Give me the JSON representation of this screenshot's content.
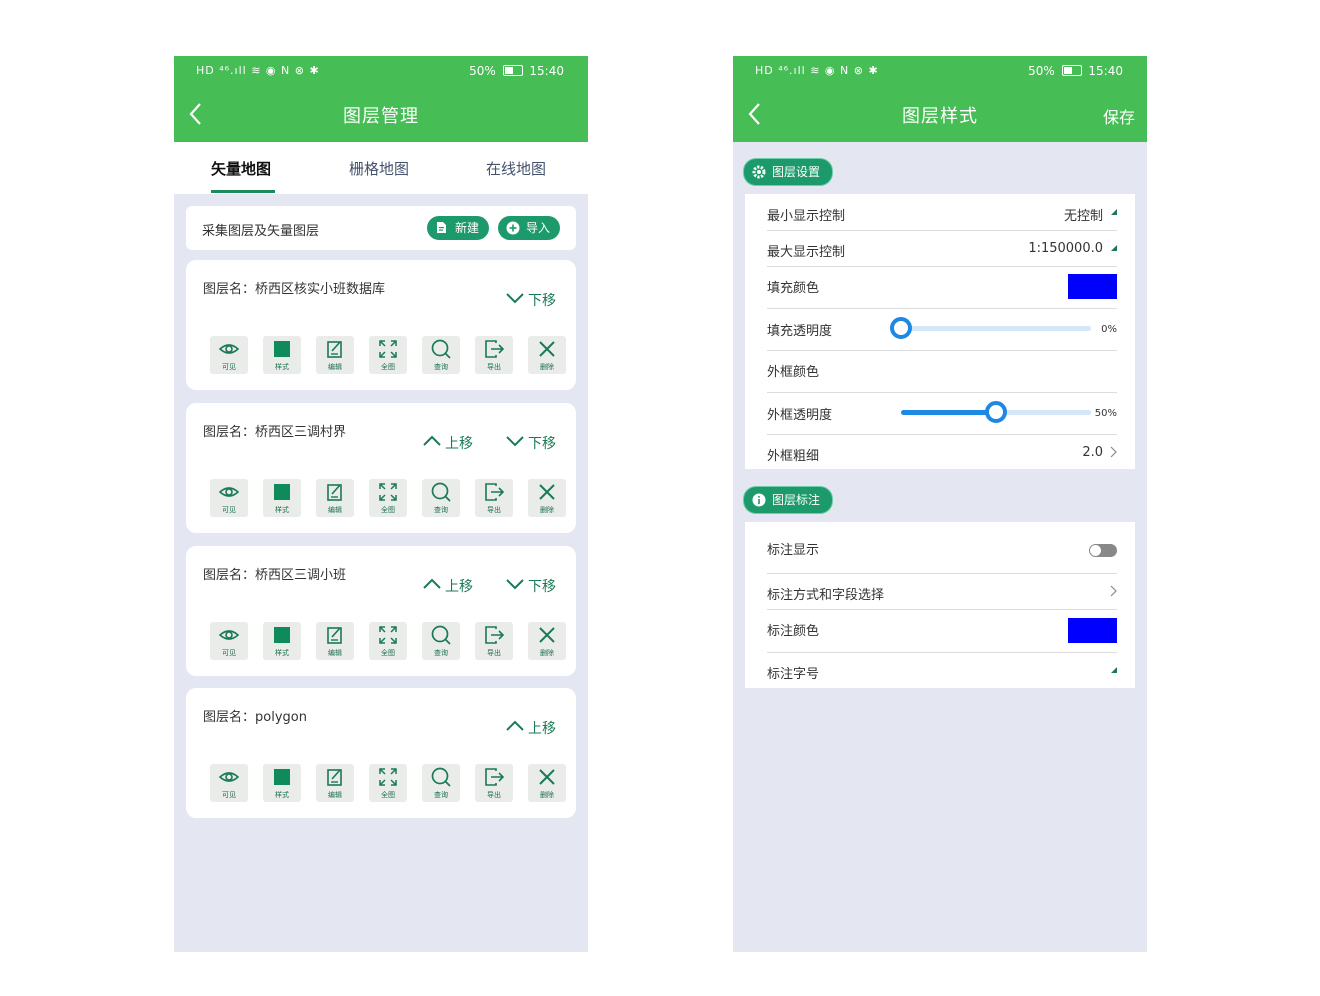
{
  "status_bar": {
    "icons_left": "HD ⁴⁶.ıll ≋ ◉ N ⊗ ✱",
    "battery_percent": "50%",
    "time": "15:40"
  },
  "left_screen": {
    "title": "图层管理",
    "tabs": [
      {
        "label": "矢量地图",
        "active": true
      },
      {
        "label": "栅格地图",
        "active": false
      },
      {
        "label": "在线地图",
        "active": false
      }
    ],
    "header": {
      "label": "采集图层及矢量图层",
      "new_button": "新建",
      "import_button": "导入"
    },
    "layers": [
      {
        "name": "图层名：桥西区核实小班数据库",
        "up": "",
        "down": "下移"
      },
      {
        "name": "图层名：桥西区三调村界",
        "up": "上移",
        "down": "下移"
      },
      {
        "name": "图层名：桥西区三调小班",
        "up": "上移",
        "down": "下移"
      },
      {
        "name": "图层名：polygon",
        "up": "上移",
        "down": ""
      }
    ],
    "tools": [
      {
        "icon": "eye-icon",
        "label": "可见"
      },
      {
        "icon": "square-icon",
        "label": "样式"
      },
      {
        "icon": "edit-icon",
        "label": "编辑"
      },
      {
        "icon": "expand-icon",
        "label": "全图"
      },
      {
        "icon": "search-icon",
        "label": "查询"
      },
      {
        "icon": "export-icon",
        "label": "导出"
      },
      {
        "icon": "close-icon",
        "label": "删除"
      }
    ]
  },
  "right_screen": {
    "title": "图层样式",
    "save_label": "保存",
    "settings_section": "图层设置",
    "settings": {
      "min_display_label": "最小显示控制",
      "min_display_value": "无控制",
      "max_display_label": "最大显示控制",
      "max_display_value": "1:150000.0",
      "fill_color_label": "填充颜色",
      "fill_color": "#0000ff",
      "fill_opacity_label": "填充透明度",
      "fill_opacity_text": "0%",
      "fill_opacity_value": 0,
      "border_color_label": "外框颜色",
      "border_opacity_label": "外框透明度",
      "border_opacity_text": "50%",
      "border_opacity_value": 0.5,
      "border_width_label": "外框粗细",
      "border_width_value": "2.0"
    },
    "label_section": "图层标注",
    "labels": {
      "show_label": "标注显示",
      "show_enabled": false,
      "mode_label": "标注方式和字段选择",
      "color_label": "标注颜色",
      "color": "#0000ff",
      "font_size_label": "标注字号"
    }
  },
  "colors": {
    "app_bar": "#47bd55",
    "accent": "#1c9a6c",
    "background": "#e4e7f1",
    "slider": "#1e88e5"
  }
}
